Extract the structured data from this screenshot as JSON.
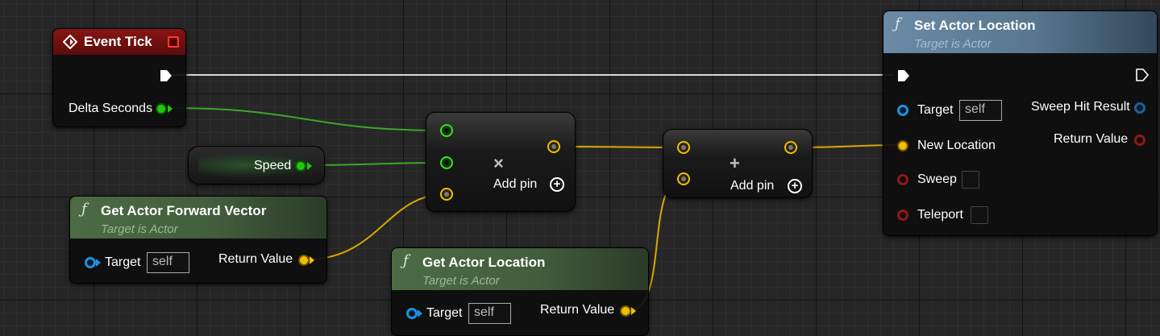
{
  "nodes": {
    "event_tick": {
      "title": "Event Tick",
      "pin_delta": "Delta Seconds"
    },
    "speed": {
      "label": "Speed"
    },
    "forward_vector": {
      "title": "Get Actor Forward Vector",
      "subtitle": "Target is Actor",
      "pin_target": "Target",
      "target_value": "self",
      "pin_return": "Return Value"
    },
    "get_location": {
      "title": "Get Actor Location",
      "subtitle": "Target is Actor",
      "pin_target": "Target",
      "target_value": "self",
      "pin_return": "Return Value"
    },
    "multiply": {
      "operator": "×",
      "add_pin": "Add pin",
      "plus": "+"
    },
    "add": {
      "operator": "+",
      "add_pin": "Add pin",
      "plus": "+"
    },
    "set_location": {
      "title": "Set Actor Location",
      "subtitle": "Target is Actor",
      "pin_target": "Target",
      "target_value": "self",
      "pin_new_location": "New Location",
      "pin_sweep": "Sweep",
      "pin_teleport": "Teleport",
      "pin_sweep_hit": "Sweep Hit Result",
      "pin_return": "Return Value"
    }
  },
  "icons": {
    "function": "ƒ",
    "event": "event-diamond-icon"
  },
  "colors": {
    "float": "#22c611",
    "vector": "#f0c000",
    "object": "#1e90e0",
    "bool": "#8a1a1a",
    "exec": "#ffffff",
    "event_header": "#8a1414",
    "func_green": "#4c6b44",
    "func_blue": "#6a8aa6"
  }
}
